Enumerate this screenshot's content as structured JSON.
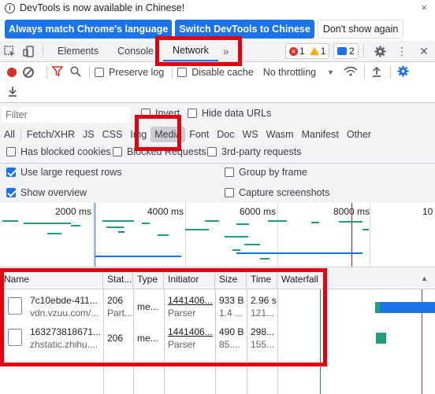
{
  "infobar": {
    "message": "DevTools is now available in Chinese!",
    "btn_match": "Always match Chrome's language",
    "btn_switch": "Switch DevTools to Chinese",
    "btn_dismiss": "Don't show again",
    "close": "×"
  },
  "tabs": {
    "elements": "Elements",
    "console": "Console",
    "network": "Network",
    "more": "»",
    "errors": "1",
    "warnings": "1",
    "messages": "2"
  },
  "toolbar": {
    "preserve_log": "Preserve log",
    "disable_cache": "Disable cache",
    "throttling": "No throttling"
  },
  "filter": {
    "placeholder": "Filter",
    "invert": "Invert",
    "hide_data_urls": "Hide data URLs",
    "types": [
      "All",
      "Fetch/XHR",
      "JS",
      "CSS",
      "Img",
      "Media",
      "Font",
      "Doc",
      "WS",
      "Wasm",
      "Manifest",
      "Other"
    ],
    "selected_type": "Media",
    "has_blocked_cookies": "Has blocked cookies",
    "blocked_requests": "Blocked Requests",
    "third_party": "3rd-party requests",
    "large_rows": "Use large request rows",
    "group_by_frame": "Group by frame",
    "show_overview": "Show overview",
    "capture_screenshots": "Capture screenshots"
  },
  "overview": {
    "ticks": [
      "2000 ms",
      "4000 ms",
      "6000 ms",
      "8000 ms",
      "10"
    ]
  },
  "table": {
    "headers": [
      "Name",
      "Stat...",
      "Type",
      "Initiator",
      "Size",
      "Time",
      "Waterfall"
    ],
    "rows": [
      {
        "name": "7c10ebde-411...",
        "domain": "vdn.vzuu.com/...",
        "status": "206",
        "status_text": "Part...",
        "type": "me...",
        "initiator": "1441406...",
        "initiator_type": "Parser",
        "size": "933 B",
        "size2": "1.4 ...",
        "time": "2.96 s",
        "time2": "121..."
      },
      {
        "name": "163273818671...",
        "domain": "zhstatic.zhihu....",
        "status": "206",
        "status_text": "",
        "type": "me...",
        "initiator": "1441406...",
        "initiator_type": "Parser",
        "size": "490 B",
        "size2": "85....",
        "time": "298...",
        "time2": "155..."
      }
    ]
  },
  "colors": {
    "accent": "#1a73e8",
    "record": "#d93025",
    "highlight_box": "#e3000f"
  }
}
